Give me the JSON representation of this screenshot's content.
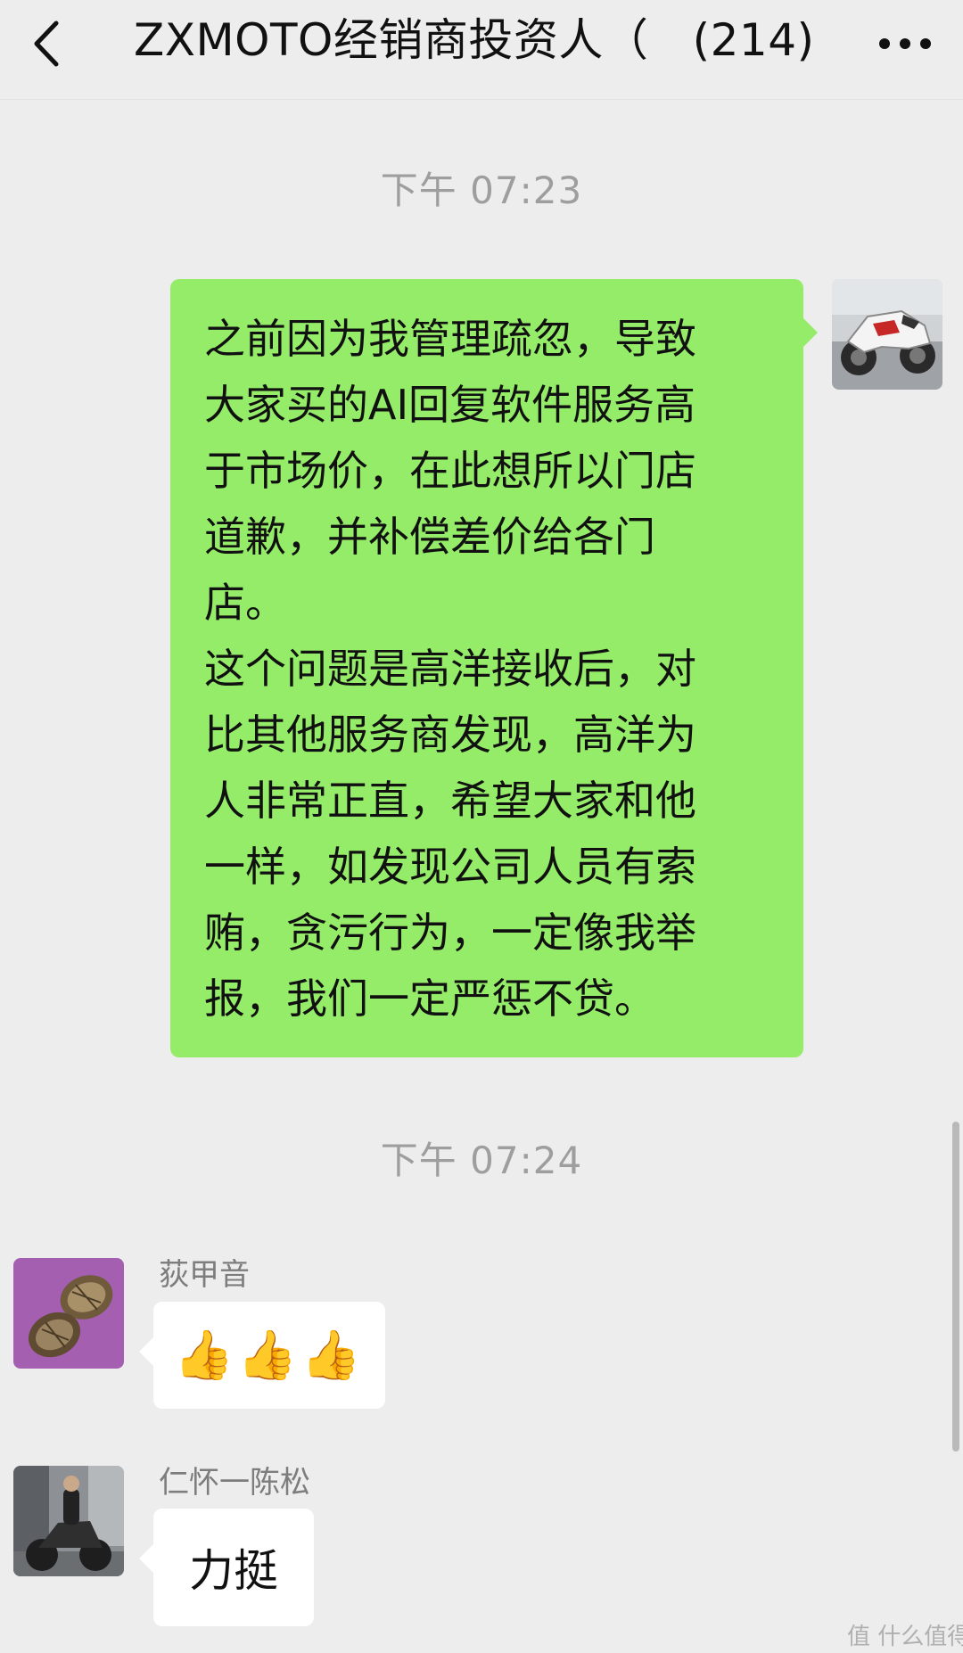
{
  "header": {
    "back_icon": "chevron-left-icon",
    "title": "ZXMOTO经销商投资人（   (214)",
    "more_icon": "more-dots-icon"
  },
  "messages": [
    {
      "timestamp": "下午 07:23"
    },
    {
      "direction": "outgoing",
      "avatar": "motorcycle-avatar",
      "text": "之前因为我管理疏忽，导致\n大家买的AI回复软件服务高\n于市场价，在此想所以门店\n道歉，并补偿差价给各门\n店。\n这个问题是高洋接收后，对\n比其他服务商发现，高洋为\n人非常正直，希望大家和他\n一样，如发现公司人员有索\n贿，贪污行为，一定像我举\n报，我们一定严惩不贷。"
    },
    {
      "timestamp": "下午 07:24"
    },
    {
      "direction": "incoming",
      "sender": "荻甲音",
      "avatar": "seed-pods-avatar",
      "emoji": "👍👍👍"
    },
    {
      "direction": "incoming",
      "sender": "仁怀一陈松",
      "avatar": "rider-motorcycle-avatar",
      "text": "力挺"
    }
  ],
  "watermark": "值 什么值得买",
  "colors": {
    "background": "#ededed",
    "outgoing_bubble": "#95ec69",
    "incoming_bubble": "#ffffff",
    "timestamp": "#9e9e9e"
  }
}
